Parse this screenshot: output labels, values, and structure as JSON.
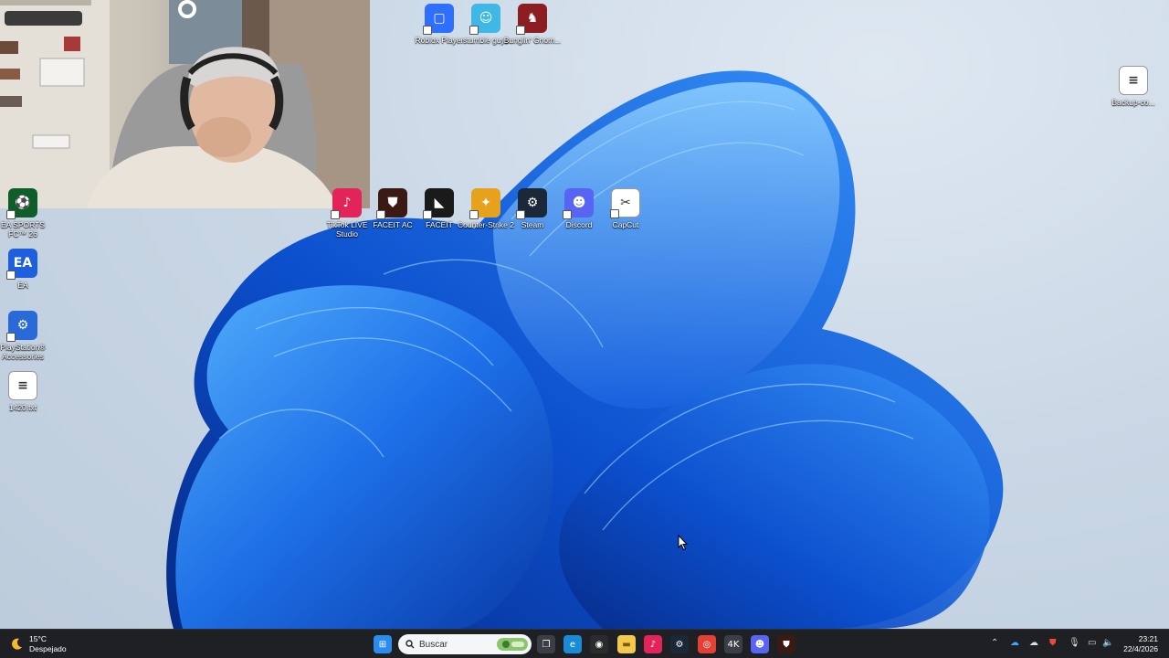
{
  "colors": {
    "taskbar_bg": "#1e2023",
    "bloom_dark": "#0a3bb0",
    "bloom_light": "#3aa2f7",
    "wallpaper_bg": "#c9d6e4"
  },
  "desktop": {
    "icons_top": [
      {
        "label": "Roblox Player",
        "icon": "roblox-icon",
        "color": "#2f6fff",
        "glyph": "▢"
      },
      {
        "label": "stumble guys",
        "icon": "stumble-guys-icon",
        "color": "#3fb8e6",
        "glyph": "☺"
      },
      {
        "label": "Bunglin' Gnom...",
        "icon": "gnome-game-icon",
        "color": "#8c1d20",
        "glyph": "♞"
      }
    ],
    "icons_middle": [
      {
        "label": "TikTok LIVE Studio",
        "icon": "tiktok-live-icon",
        "color": "#e2245a",
        "glyph": "♪"
      },
      {
        "label": "FACEIT AC",
        "icon": "faceit-ac-icon",
        "color": "#3a1a12",
        "glyph": "⛊"
      },
      {
        "label": "FACEIT",
        "icon": "faceit-icon",
        "color": "#1a1a1a",
        "glyph": "◣"
      },
      {
        "label": "Counter-Strike 2",
        "icon": "counter-strike-icon",
        "color": "#e6a11d",
        "glyph": "✦"
      },
      {
        "label": "Steam",
        "icon": "steam-icon",
        "color": "#1b2838",
        "glyph": "⚙"
      },
      {
        "label": "Discord",
        "icon": "discord-icon",
        "color": "#5865f2",
        "glyph": "☻"
      },
      {
        "label": "CapCut",
        "icon": "capcut-icon",
        "color": "#ffffff",
        "glyph": "✂"
      }
    ],
    "icons_left": [
      {
        "label": "EA SPORTS FC™ 26",
        "icon": "ea-sports-fc-icon",
        "color": "#0f5e2a",
        "glyph": "⚽"
      },
      {
        "label": "EA",
        "icon": "ea-icon",
        "color": "#1e5fde",
        "glyph": "EA"
      },
      {
        "label": "PlayStation® Accessories",
        "icon": "playstation-accessories-icon",
        "color": "#2a6ad8",
        "glyph": "⚙"
      },
      {
        "label": "1420.txt",
        "icon": "text-file-icon",
        "color": "#ffffff",
        "glyph": "≡"
      }
    ],
    "icons_right": [
      {
        "label": "Backup-co...",
        "icon": "text-file-icon",
        "color": "#ffffff",
        "glyph": "≡"
      }
    ]
  },
  "taskbar": {
    "weather": {
      "temp": "15°C",
      "condition": "Despejado",
      "icon": "moon-weather-icon"
    },
    "search_placeholder": "Buscar",
    "apps": [
      {
        "name": "start-button",
        "icon": "windows-logo-icon",
        "color": "#2b8cf0",
        "glyph": "⊞"
      },
      {
        "name": "task-view",
        "icon": "task-view-icon",
        "color": "#3b3f45",
        "glyph": "❐"
      },
      {
        "name": "edge",
        "icon": "edge-icon",
        "color": "#1a8bd6",
        "glyph": "e"
      },
      {
        "name": "obs",
        "icon": "obs-icon",
        "color": "#2b2b2b",
        "glyph": "◉"
      },
      {
        "name": "file-explorer",
        "icon": "folder-icon",
        "color": "#f2c94c",
        "glyph": "▬"
      },
      {
        "name": "tiktok-live",
        "icon": "tiktok-live-icon",
        "color": "#e2245a",
        "glyph": "♪"
      },
      {
        "name": "steam",
        "icon": "steam-icon",
        "color": "#1b2838",
        "glyph": "⚙"
      },
      {
        "name": "chrome",
        "icon": "chrome-icon",
        "color": "#e34133",
        "glyph": "◎"
      },
      {
        "name": "4k-video",
        "icon": "4k-icon",
        "color": "#3b3f45",
        "glyph": "4K"
      },
      {
        "name": "discord",
        "icon": "discord-icon",
        "color": "#5865f2",
        "glyph": "☻"
      },
      {
        "name": "faceit-ac",
        "icon": "faceit-ac-icon",
        "color": "#3a1a12",
        "glyph": "⛊"
      }
    ],
    "tray": {
      "icons": [
        "chevron-up-icon",
        "onedrive-icon",
        "cloud-icon",
        "faceit-ac-icon",
        "microphone-icon",
        "display-icon",
        "speaker-icon"
      ],
      "time": "23:21",
      "date": "22/4/2026"
    }
  }
}
